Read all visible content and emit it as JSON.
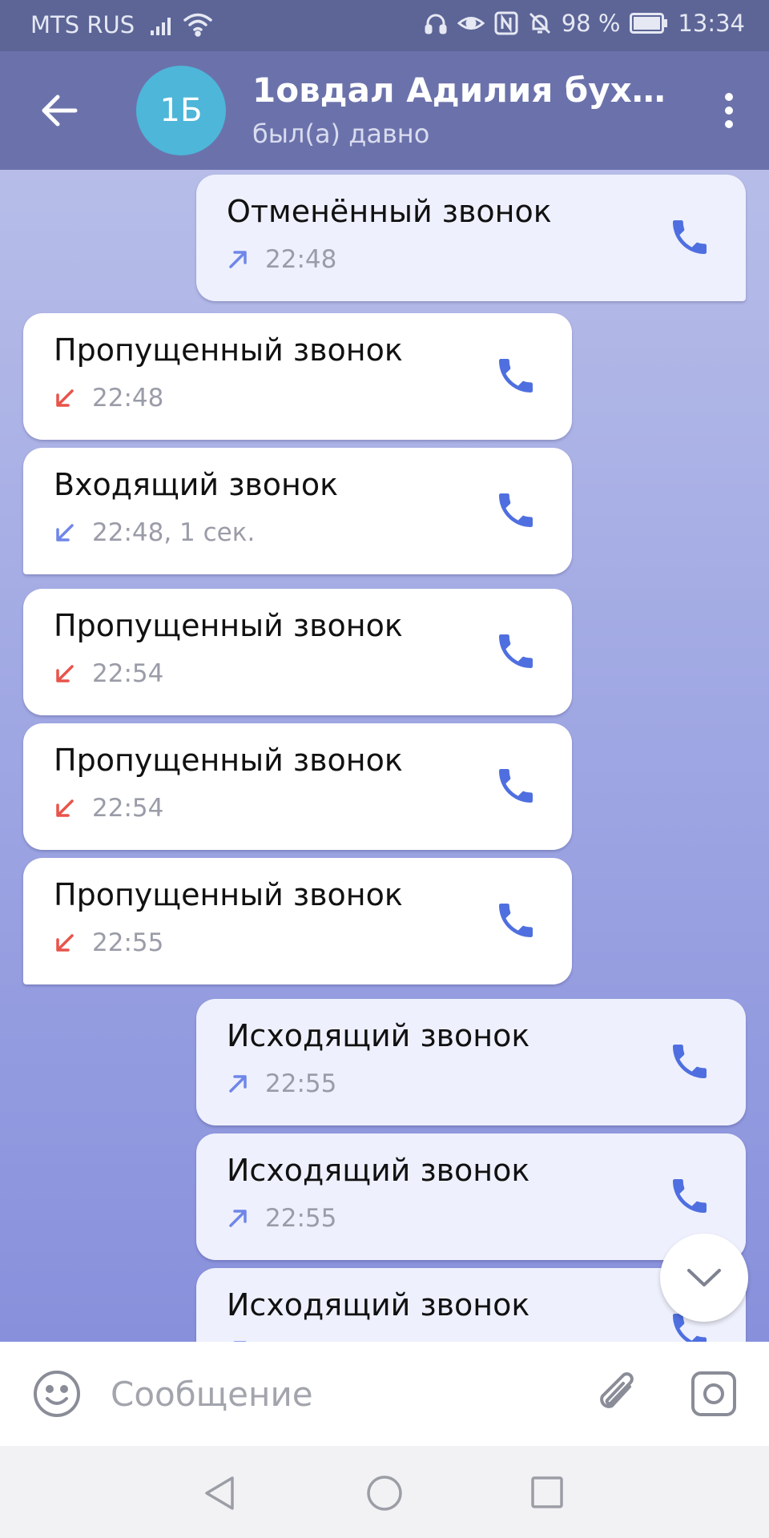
{
  "status_bar": {
    "carrier": "MTS RUS",
    "battery": "98 %",
    "time": "13:34"
  },
  "header": {
    "avatar_initials": "1Б",
    "title": "1овдал Адилия буха...",
    "subtitle": "был(а) давно"
  },
  "messages": [
    {
      "direction": "out",
      "title": "Отменённый звонок",
      "meta": "22:48",
      "arrow": "outgoing-arrow",
      "arrow_color": "#6f86e8"
    },
    {
      "direction": "in",
      "title": "Пропущенный звонок",
      "meta": "22:48",
      "arrow": "missed-arrow",
      "arrow_color": "#e8544a"
    },
    {
      "direction": "in",
      "title": "Входящий звонок",
      "meta": "22:48, 1 сек.",
      "arrow": "incoming-arrow",
      "arrow_color": "#6f86e8"
    },
    {
      "direction": "in",
      "title": "Пропущенный звонок",
      "meta": "22:54",
      "arrow": "missed-arrow",
      "arrow_color": "#e8544a"
    },
    {
      "direction": "in",
      "title": "Пропущенный звонок",
      "meta": "22:54",
      "arrow": "missed-arrow",
      "arrow_color": "#e8544a"
    },
    {
      "direction": "in",
      "title": "Пропущенный звонок",
      "meta": "22:55",
      "arrow": "missed-arrow",
      "arrow_color": "#e8544a"
    },
    {
      "direction": "out",
      "title": "Исходящий звонок",
      "meta": "22:55",
      "arrow": "outgoing-arrow",
      "arrow_color": "#6f86e8"
    },
    {
      "direction": "out",
      "title": "Исходящий звонок",
      "meta": "22:55",
      "arrow": "outgoing-arrow",
      "arrow_color": "#6f86e8"
    },
    {
      "direction": "out",
      "title": "Исходящий звонок",
      "meta": "",
      "arrow": "outgoing-arrow",
      "arrow_color": "#6f86e8"
    }
  ],
  "input": {
    "placeholder": "Сообщение",
    "value": ""
  },
  "colors": {
    "header_bg": "#6b72ab",
    "status_bg": "#5c6596",
    "phone_icon": "#4f6fe0",
    "missed": "#e8544a",
    "accent": "#6f86e8"
  }
}
